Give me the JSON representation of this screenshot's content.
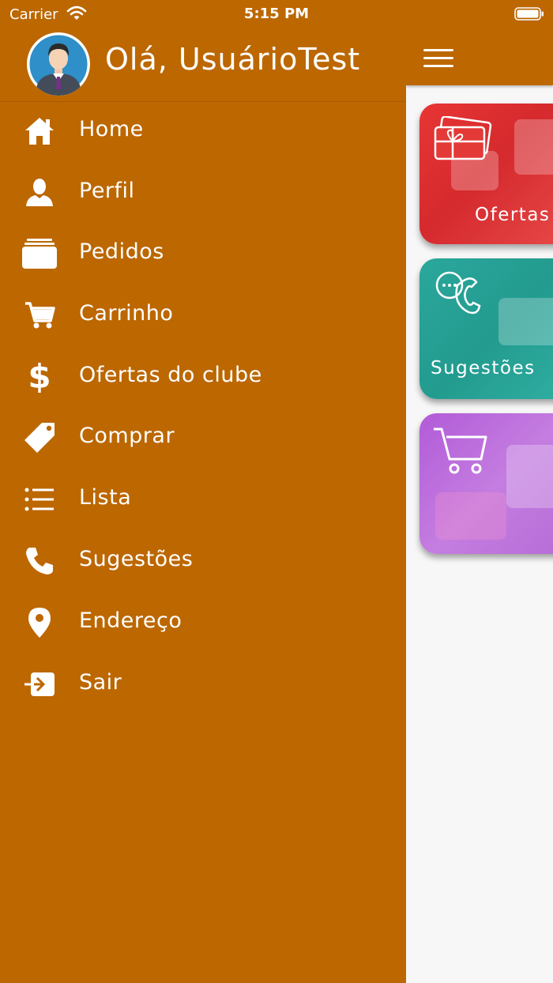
{
  "status_bar": {
    "carrier": "Carrier",
    "time": "5:15 PM"
  },
  "drawer": {
    "greeting": "Olá, UsuárioTest",
    "items": [
      {
        "label": "Home",
        "icon": "home-icon"
      },
      {
        "label": "Perfil",
        "icon": "user-icon"
      },
      {
        "label": "Pedidos",
        "icon": "orders-icon"
      },
      {
        "label": "Carrinho",
        "icon": "cart-icon"
      },
      {
        "label": "Ofertas do clube",
        "icon": "dollar-icon"
      },
      {
        "label": "Comprar",
        "icon": "tag-icon"
      },
      {
        "label": "Lista",
        "icon": "list-icon"
      },
      {
        "label": "Sugestões",
        "icon": "phone-icon"
      },
      {
        "label": "Endereço",
        "icon": "location-pin-icon"
      },
      {
        "label": "Sair",
        "icon": "sign-in-icon"
      }
    ]
  },
  "cards": {
    "ofertas": {
      "label": "Ofertas",
      "icon": "gift-card-icon"
    },
    "sugestoes": {
      "label": "Sugestões",
      "icon": "chat-phone-icon"
    },
    "comprar": {
      "label": "",
      "icon": "cart-icon"
    }
  },
  "colors": {
    "primary": "#bc6700",
    "ofertas_card": "#e83534",
    "sugestoes_card": "#2ba79c",
    "comprar_card": "#b25bd8"
  }
}
